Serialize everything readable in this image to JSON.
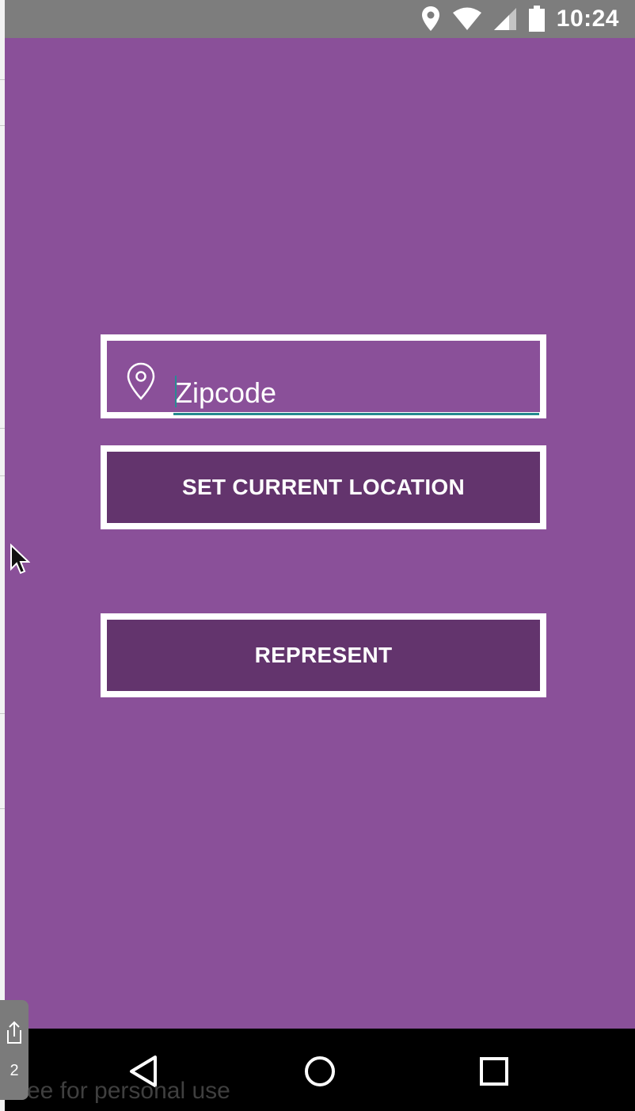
{
  "status_bar": {
    "time": "10:24",
    "icons": [
      "location-icon",
      "wifi-icon",
      "signal-icon",
      "battery-icon"
    ]
  },
  "form": {
    "zipcode_placeholder": "Zipcode",
    "zipcode_value": "",
    "location_button_label": "SET CURRENT LOCATION",
    "represent_button_label": "REPRESENT"
  },
  "nav_bar": {
    "buttons": [
      "back-icon",
      "home-icon",
      "recents-icon"
    ]
  },
  "overlay": {
    "share_count": "2",
    "watermark": "ee for personal use"
  },
  "colors": {
    "background": "#8a5099",
    "button_fill": "#63346d",
    "border": "#ffffff",
    "input_underline": "#23898f",
    "status_bar": "#7d7d7d",
    "nav_bar": "#000000"
  }
}
